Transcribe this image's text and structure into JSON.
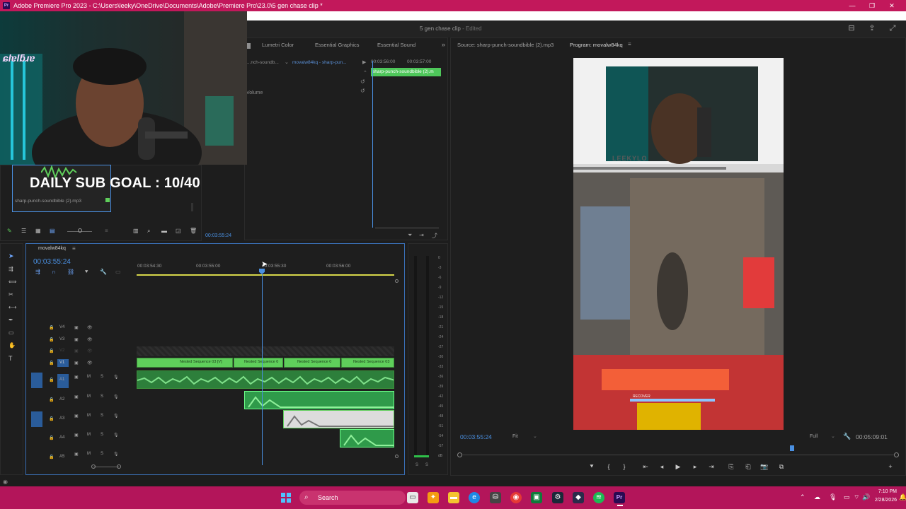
{
  "window": {
    "title": "Adobe Premiere Pro 2023 - C:\\Users\\leeky\\OneDrive\\Documents\\Adobe\\Premiere Pro\\23.0\\5 gen chase clip *",
    "project_name": "5 gen chase clip",
    "project_state": "- Edited"
  },
  "stream_overlay": {
    "goal_text": "DAILY SUB GOAL : 10/40",
    "webcam_logo": "ɕlɐlƃɹɐ"
  },
  "effect_controls": {
    "tabs": [
      "Lumetri Color",
      "Essential Graphics",
      "Essential Sound"
    ],
    "source_label": "...nch-soundb...",
    "clip_label": "movalw84kq - sharp-pun...",
    "property": "Volume",
    "mini_clip": "sharp-punch-soundbible (2).m",
    "time_a": "00:03:56:00",
    "time_b": "00:03:57:00",
    "timecode": "00:03:55:24"
  },
  "project_panel": {
    "item_name": "sharp-punch-soundbible (2).mp3"
  },
  "source_monitor": {
    "tab": "Source: sharp-punch-soundbible (2).mp3"
  },
  "program_monitor": {
    "tab": "Program: movalw84kq",
    "current_time": "00:03:55:24",
    "fit": "Fit",
    "quality": "Full",
    "duration": "00:05:09:01",
    "hud_text": "RECOVER",
    "banner_text": "LEEKYLO"
  },
  "timeline": {
    "sequence_name": "movalw84kq",
    "current_time": "00:03:55:24",
    "ruler": [
      "00:03:54:30",
      "00:03:55:00",
      "00:03:55:30",
      "00:03:56:00"
    ],
    "video_tracks": [
      "V4",
      "V3",
      "V2",
      "V1"
    ],
    "audio_tracks": [
      "A1",
      "A2",
      "A3",
      "A4",
      "A5"
    ],
    "clips": [
      "Nested Sequence 03 [V]",
      "Nested Sequence 0",
      "Nested Sequence 0",
      "Nested Sequence 03"
    ]
  },
  "audio_meter": {
    "labels": [
      "0",
      "-3",
      "-6",
      "-9",
      "-12",
      "-15",
      "-18",
      "-21",
      "-24",
      "-27",
      "-30",
      "-33",
      "-36",
      "-39",
      "-42",
      "-45",
      "-48",
      "-51",
      "-54",
      "-57",
      "dB"
    ],
    "solo": [
      "S",
      "S"
    ]
  },
  "taskbar": {
    "search_label": "Search",
    "time": "7:10 PM",
    "date": "2/28/2026"
  },
  "colors": {
    "accent": "#c2185b",
    "clip_green": "#5fcf5b",
    "selection_blue": "#3a6fb5",
    "playhead": "#4a90e2"
  }
}
